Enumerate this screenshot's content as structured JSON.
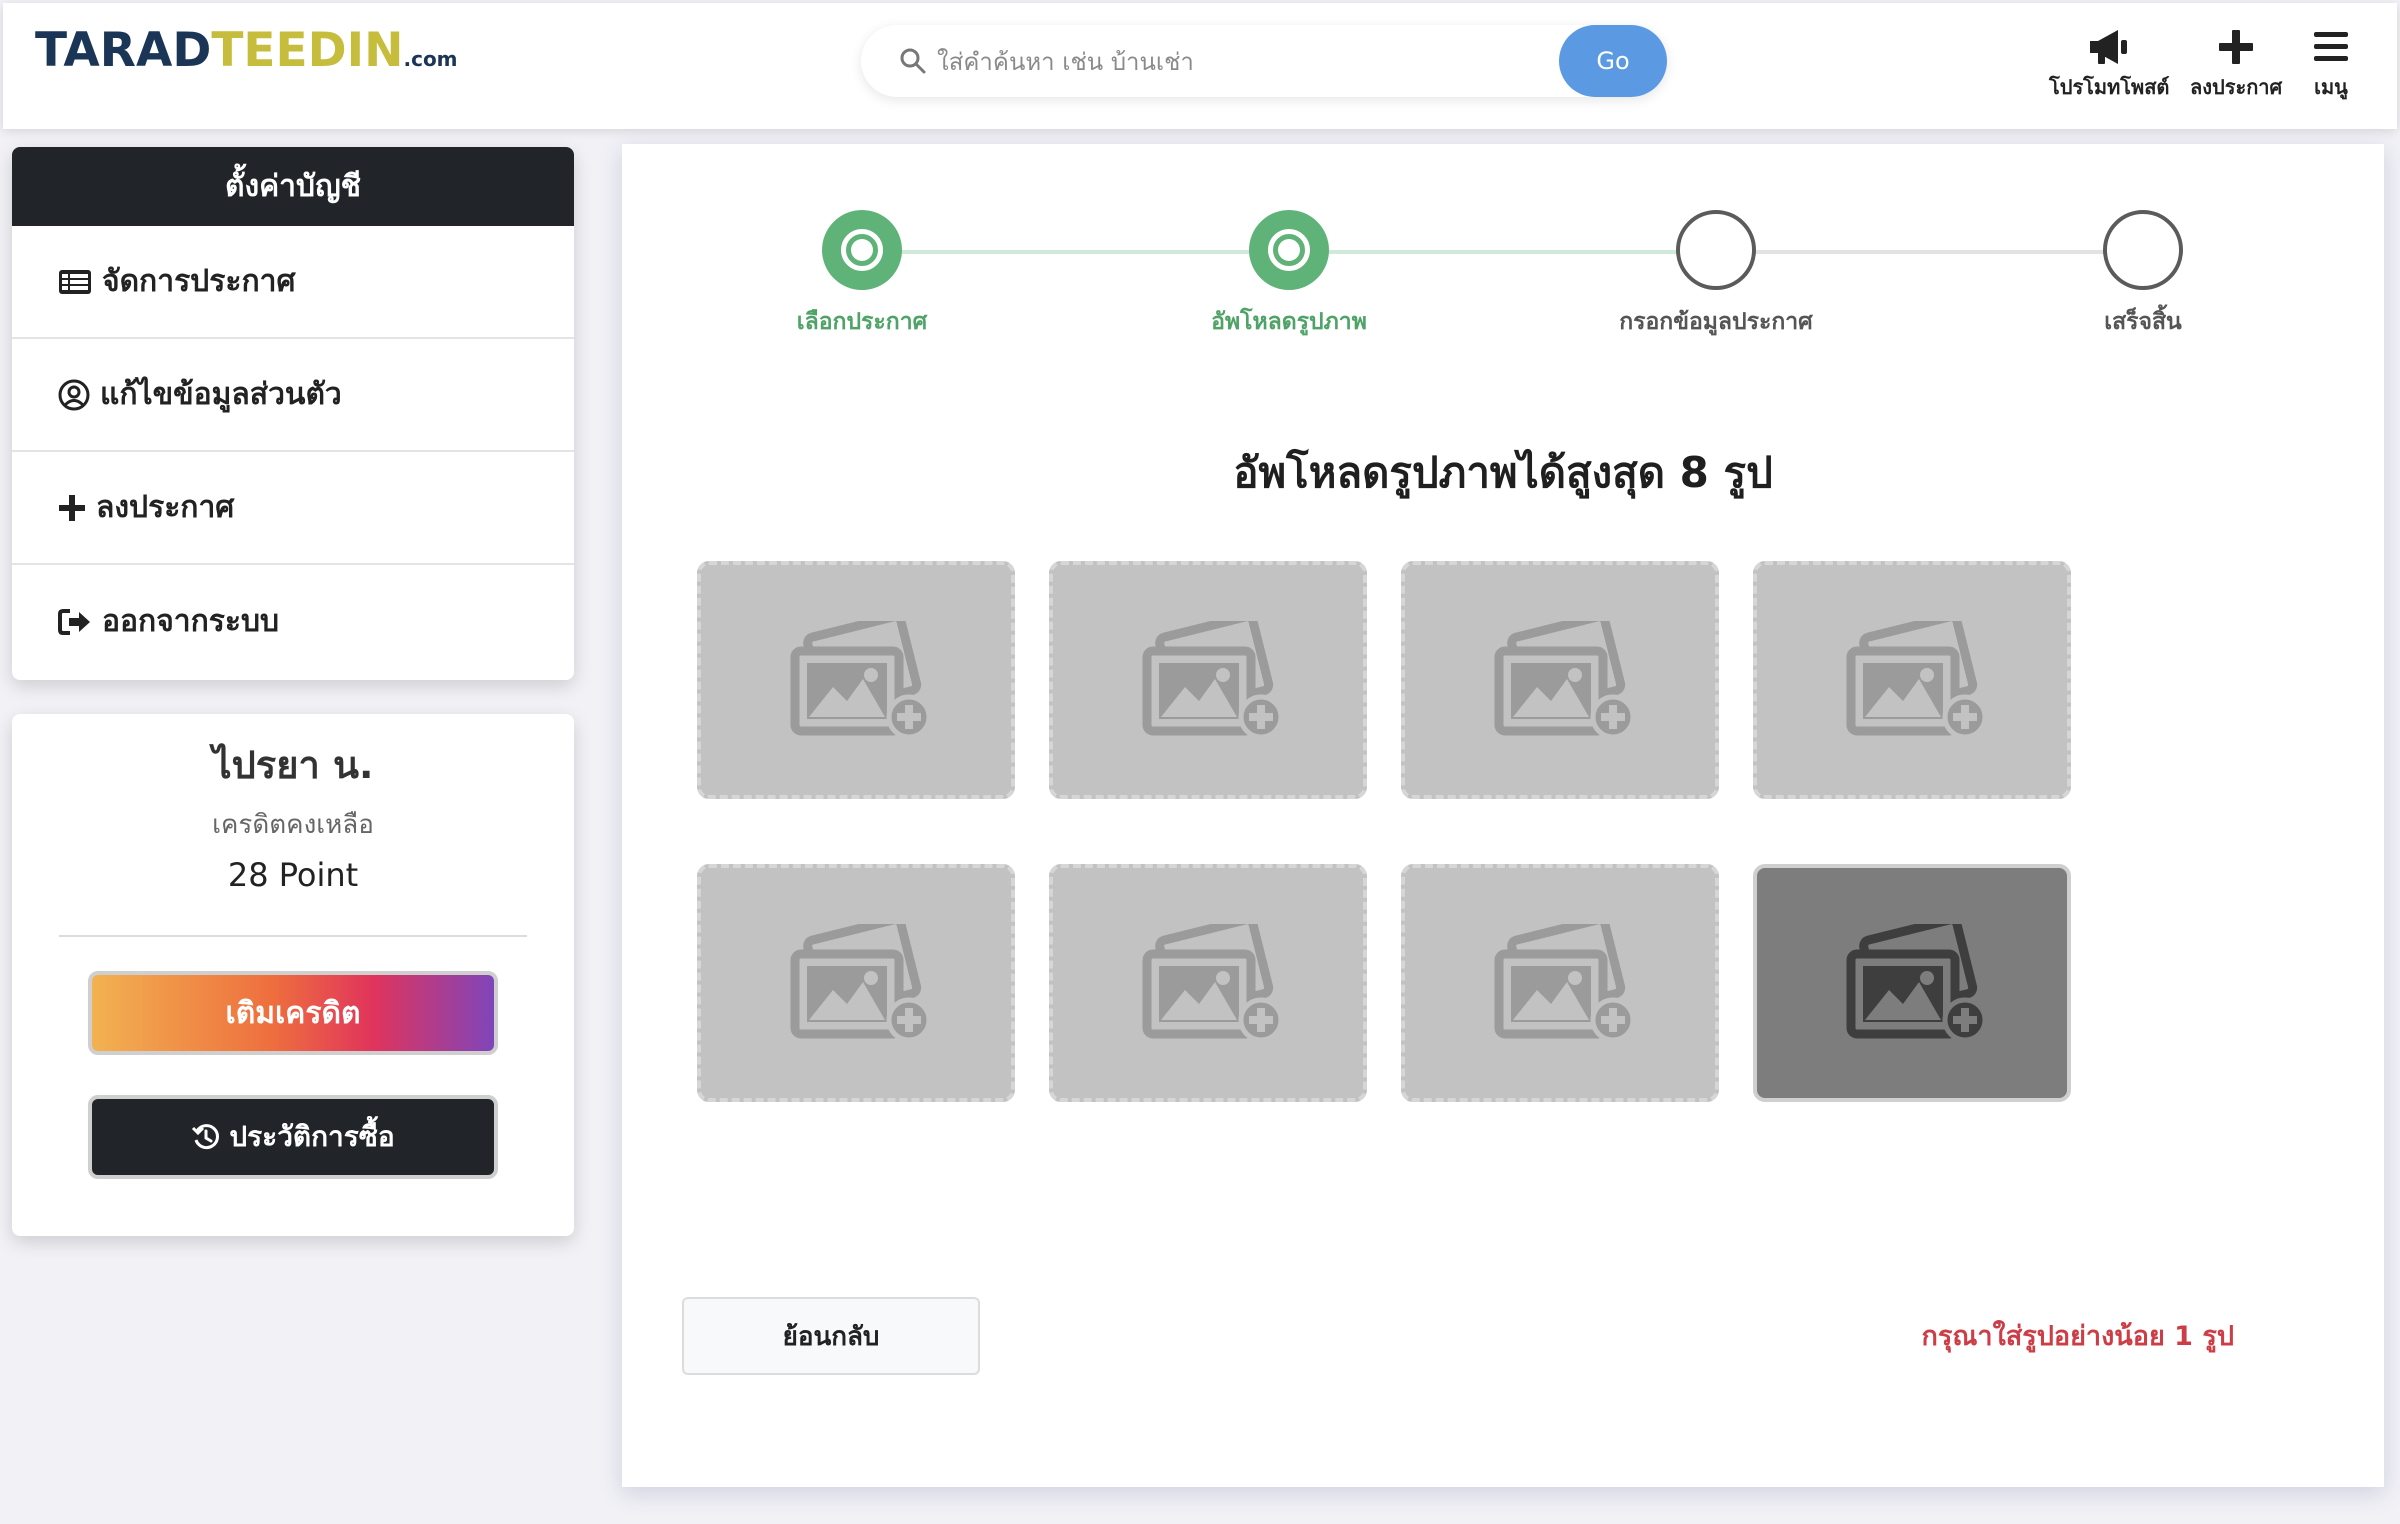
{
  "header": {
    "logo": {
      "part1": "TARAD",
      "part2": "TEEDIN",
      "part3": ".com"
    },
    "search": {
      "placeholder": "ใส่คำค้นหา เช่น บ้านเช่า",
      "go_label": "Go"
    },
    "nav": [
      {
        "label": "โปรโมทโพสต์",
        "icon": "megaphone-icon"
      },
      {
        "label": "ลงประกาศ",
        "icon": "plus-icon"
      },
      {
        "label": "เมนู",
        "icon": "hamburger-menu-icon"
      }
    ]
  },
  "sidebar": {
    "title": "ตั้งค่าบัญชี",
    "items": [
      {
        "label": "จัดการประกาศ",
        "icon": "list-table-icon"
      },
      {
        "label": "แก้ไขข้อมูลส่วนตัว",
        "icon": "user-circle-icon"
      },
      {
        "label": "ลงประกาศ",
        "icon": "plus-icon"
      },
      {
        "label": "ออกจากระบบ",
        "icon": "sign-out-icon"
      }
    ],
    "profile": {
      "name": "ไปรยา น.",
      "credit_label": "เครดิตคงเหลือ",
      "credit_value": "28 Point",
      "topup_label": "เติมเครดิต",
      "history_label": "ประวัติการซื้อ"
    }
  },
  "steps": [
    {
      "label": "เลือกประกาศ",
      "state": "completed"
    },
    {
      "label": "อัพโหลดรูปภาพ",
      "state": "current"
    },
    {
      "label": "กรอกข้อมูลประกาศ",
      "state": "pending"
    },
    {
      "label": "เสร็จสิ้น",
      "state": "pending"
    }
  ],
  "upload": {
    "title": "อัพโหลดรูปภาพได้สูงสุด 8 รูป",
    "slot_count": 8,
    "hovered_slot": 8,
    "slot_icon": "add-image-icon"
  },
  "footer": {
    "back_label": "ย้อนกลับ",
    "error": "กรุณาใส่รูปอย่างน้อย 1 รูป"
  },
  "colors": {
    "brand_dark": "#1b3556",
    "brand_gold": "#c7bd3c",
    "step_active": "#5fb378",
    "go_button": "#5b9ae3",
    "error": "#cd3d45",
    "sidebar_header": "#212529"
  }
}
